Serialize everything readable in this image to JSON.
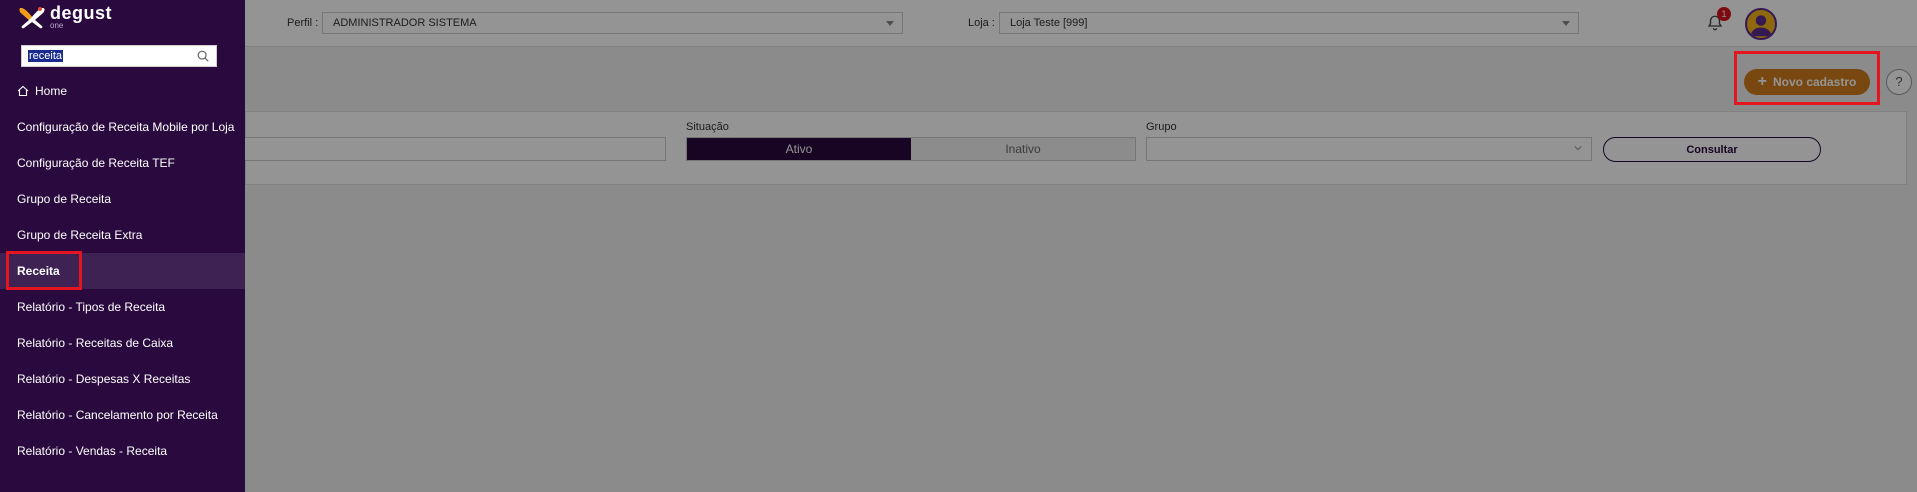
{
  "app": {
    "logo_word": "degust",
    "logo_sub": "one"
  },
  "sidebar": {
    "search": {
      "value": "receita"
    },
    "items": [
      {
        "label": "Home",
        "icon": "home-icon"
      },
      {
        "label": "Configuração de Receita Mobile por Loja"
      },
      {
        "label": "Configuração de Receita TEF"
      },
      {
        "label": "Grupo de Receita"
      },
      {
        "label": "Grupo de Receita Extra"
      },
      {
        "label": "Receita",
        "active": true
      },
      {
        "label": "Relatório - Tipos de Receita"
      },
      {
        "label": "Relatório - Receitas de Caixa"
      },
      {
        "label": "Relatório - Despesas X Receitas"
      },
      {
        "label": "Relatório - Cancelamento por Receita"
      },
      {
        "label": "Relatório - Vendas - Receita"
      }
    ]
  },
  "topbar": {
    "perfil_label": "Perfil :",
    "perfil_value": "ADMINISTRADOR SISTEMA",
    "loja_label": "Loja :",
    "loja_value": "Loja Teste [999]",
    "notification_count": "1"
  },
  "toolbar": {
    "novo_label": "Novo cadastro",
    "help_label": "?"
  },
  "filters": {
    "situacao_label": "Situação",
    "situacao_options": [
      "Ativo",
      "Inativo"
    ],
    "grupo_label": "Grupo",
    "consultar_label": "Consultar"
  },
  "colors": {
    "sidebar_bg": "#2a0a3e",
    "accent_orange": "#d07a1c",
    "highlight_red": "#e4151f"
  }
}
